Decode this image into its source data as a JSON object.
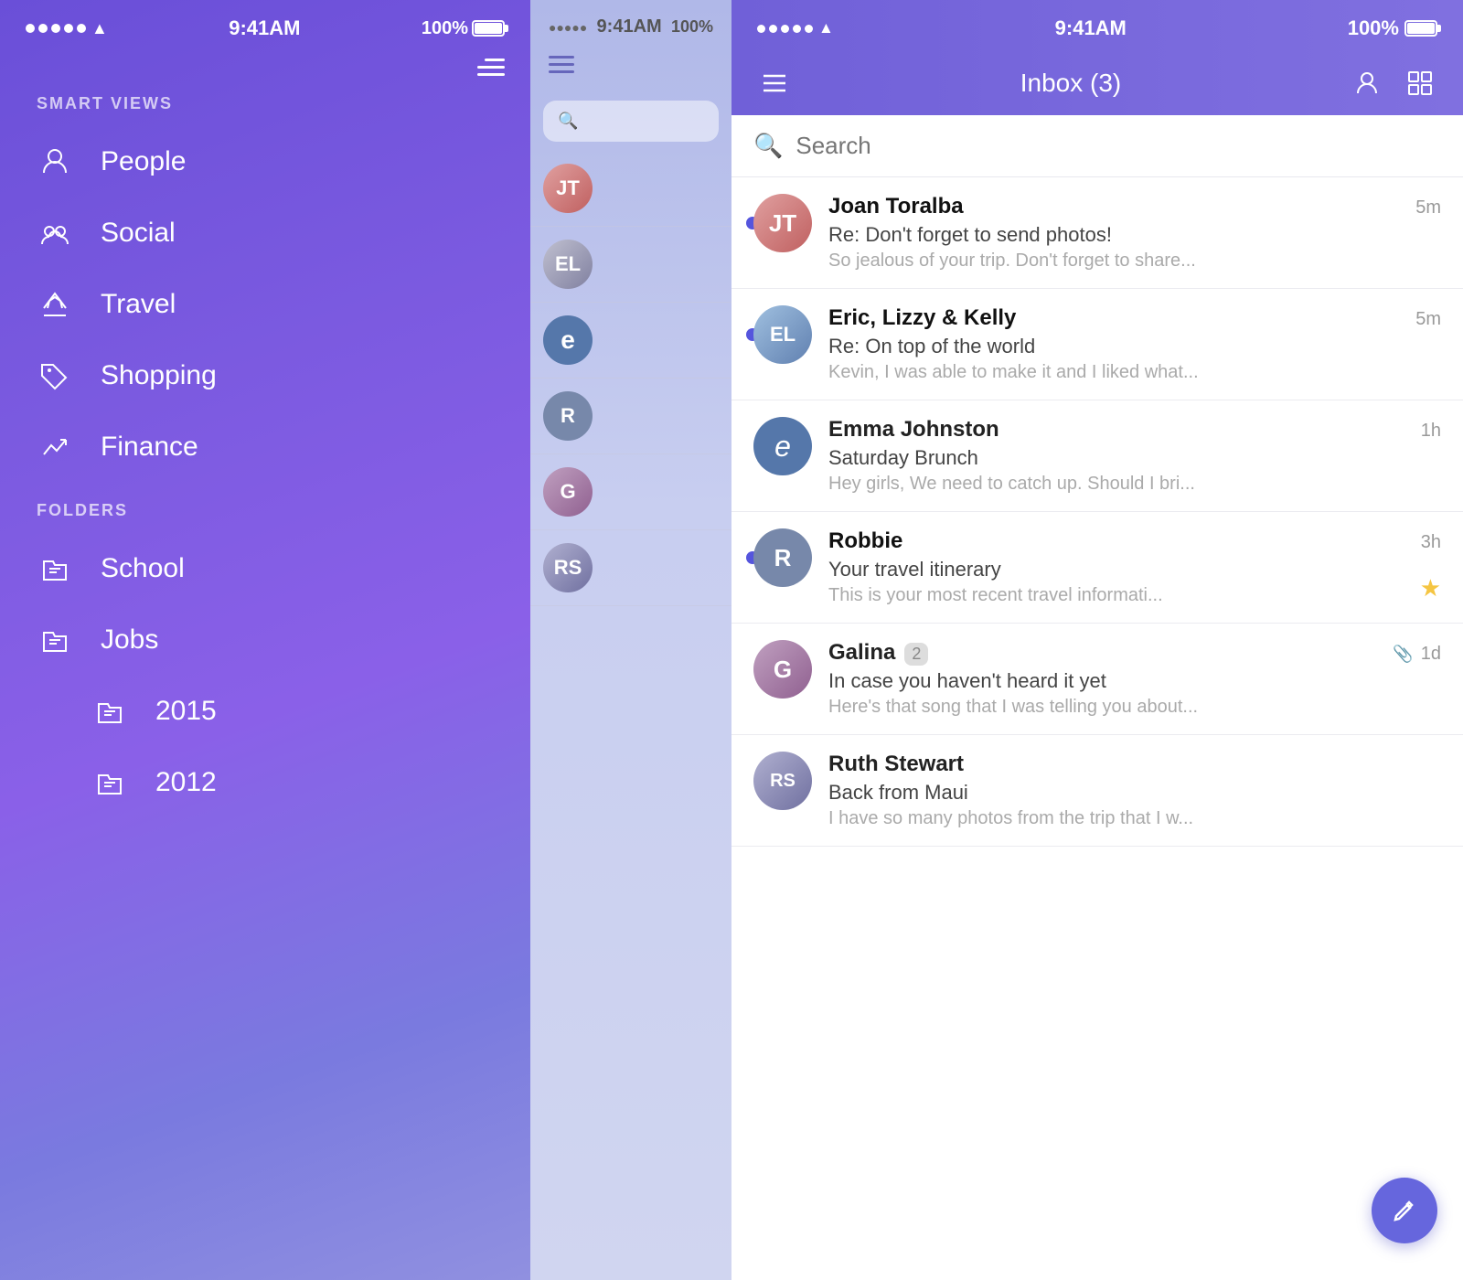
{
  "leftPhone": {
    "statusBar": {
      "time": "9:41AM",
      "battery": "100%"
    },
    "smartViewsLabel": "SMART VIEWS",
    "foldersLabel": "FOLDERS",
    "navItems": [
      {
        "id": "people",
        "label": "People",
        "icon": "person"
      },
      {
        "id": "social",
        "label": "Social",
        "icon": "social"
      },
      {
        "id": "travel",
        "label": "Travel",
        "icon": "travel"
      },
      {
        "id": "shopping",
        "label": "Shopping",
        "icon": "tag"
      },
      {
        "id": "finance",
        "label": "Finance",
        "icon": "chart"
      }
    ],
    "folderItems": [
      {
        "id": "school",
        "label": "School",
        "icon": "folder"
      },
      {
        "id": "jobs",
        "label": "Jobs",
        "icon": "folder"
      },
      {
        "id": "2015",
        "label": "2015",
        "icon": "folder",
        "sub": true
      },
      {
        "id": "2012",
        "label": "2012",
        "icon": "folder",
        "sub": true
      }
    ]
  },
  "rightPhone": {
    "statusBar": {
      "time": "9:41AM",
      "battery": "100%"
    },
    "header": {
      "title": "Inbox (3)",
      "hamburgerLabel": "menu",
      "profileLabel": "profile",
      "layoutLabel": "layout"
    },
    "search": {
      "placeholder": "Search"
    },
    "emails": [
      {
        "id": "joan",
        "sender": "Joan Toralba",
        "subject": "Re: Don't forget to send photos!",
        "preview": "So jealous of your trip. Don't forget to share...",
        "time": "5m",
        "unread": true,
        "avatarInitials": "JT",
        "avatarClass": "av-joan"
      },
      {
        "id": "eric",
        "sender": "Eric, Lizzy & Kelly",
        "subject": "Re: On top of the world",
        "preview": "Kevin, I was able to make it and I liked what...",
        "time": "5m",
        "unread": true,
        "avatarInitials": "EL",
        "avatarClass": "av-eric"
      },
      {
        "id": "emma",
        "sender": "Emma Johnston",
        "subject": "Saturday Brunch",
        "preview": "Hey girls, We need to catch up. Should I bri...",
        "time": "1h",
        "unread": false,
        "avatarInitials": "e",
        "avatarClass": "av-emma"
      },
      {
        "id": "robbie",
        "sender": "Robbie",
        "subject": "Your travel itinerary",
        "preview": "This is your most recent travel informati...",
        "time": "3h",
        "unread": true,
        "avatarInitials": "R",
        "avatarClass": "av-robbie",
        "starred": true
      },
      {
        "id": "galina",
        "sender": "Galina",
        "subject": "In case you haven't heard it yet",
        "preview": "Here's that song that I was telling you about...",
        "time": "1d",
        "unread": false,
        "avatarInitials": "G",
        "avatarClass": "av-galina",
        "badge": "2",
        "hasAttachment": true
      },
      {
        "id": "ruth",
        "sender": "Ruth Stewart",
        "subject": "Back from Maui",
        "preview": "I have so many photos from the trip that I w...",
        "time": "",
        "unread": false,
        "avatarInitials": "RS",
        "avatarClass": "av-ruth"
      }
    ],
    "fab": {
      "label": "compose"
    }
  }
}
